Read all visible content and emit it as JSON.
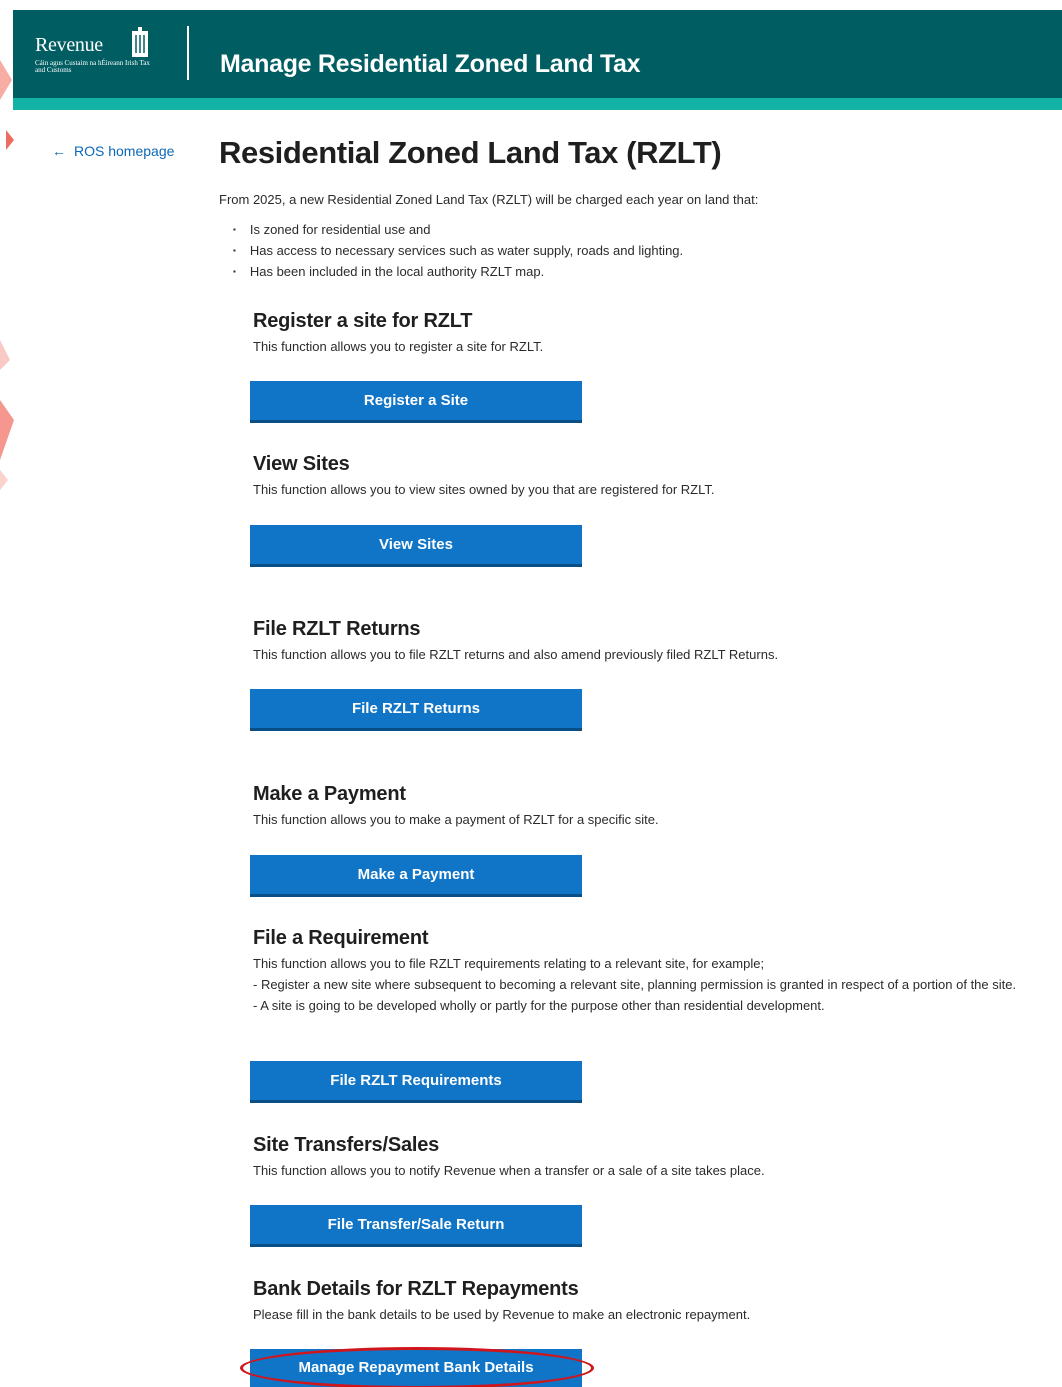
{
  "header": {
    "logo_text": "Revenue",
    "logo_subtext": "Cáin agus Custaim na hÉireann Irish Tax and Customs",
    "title": "Manage Residential Zoned Land Tax"
  },
  "nav": {
    "back_link": "ROS homepage"
  },
  "main": {
    "title": "Residential Zoned Land Tax (RZLT)",
    "intro": "From 2025, a new Residential Zoned Land Tax (RZLT) will be charged each year on land that:",
    "bullets": [
      "Is zoned for residential use and",
      "Has access to necessary services such as water supply, roads and lighting.",
      "Has been included in the local authority RZLT map."
    ],
    "sections": [
      {
        "heading": "Register a site for RZLT",
        "description": "This function allows you to register a site for RZLT.",
        "button": "Register a Site"
      },
      {
        "heading": "View Sites",
        "description": "This function allows you to view sites owned by you that are registered for RZLT.",
        "button": "View Sites"
      },
      {
        "heading": "File RZLT Returns",
        "description": "This function allows you to file RZLT returns and also amend previously filed RZLT Returns.",
        "button": "File RZLT Returns"
      },
      {
        "heading": "Make a Payment",
        "description": "This function allows you to make a payment of RZLT for a specific site.",
        "button": "Make a Payment"
      },
      {
        "heading": "File a Requirement",
        "description_lines": [
          "This function allows you to file RZLT requirements relating to a relevant site, for example;",
          "- Register a new site where subsequent to becoming a relevant site, planning permission is granted in respect of a portion of the site.",
          "- A site is going to be developed wholly or partly for the purpose other than residential development."
        ],
        "button": "File RZLT Requirements"
      },
      {
        "heading": "Site Transfers/Sales",
        "description": "This function allows you to notify Revenue when a transfer or a sale of a site takes place.",
        "button": "File Transfer/Sale Return"
      },
      {
        "heading": "Bank Details for RZLT Repayments",
        "description": "Please fill in the bank details to be used by Revenue to make an electronic repayment.",
        "button": "Manage Repayment Bank Details"
      }
    ]
  },
  "colors": {
    "header_bg": "#005e63",
    "header_strip": "#12b3a5",
    "button_bg": "#1175c7",
    "link": "#0d68b7",
    "highlight": "#d0161c"
  }
}
